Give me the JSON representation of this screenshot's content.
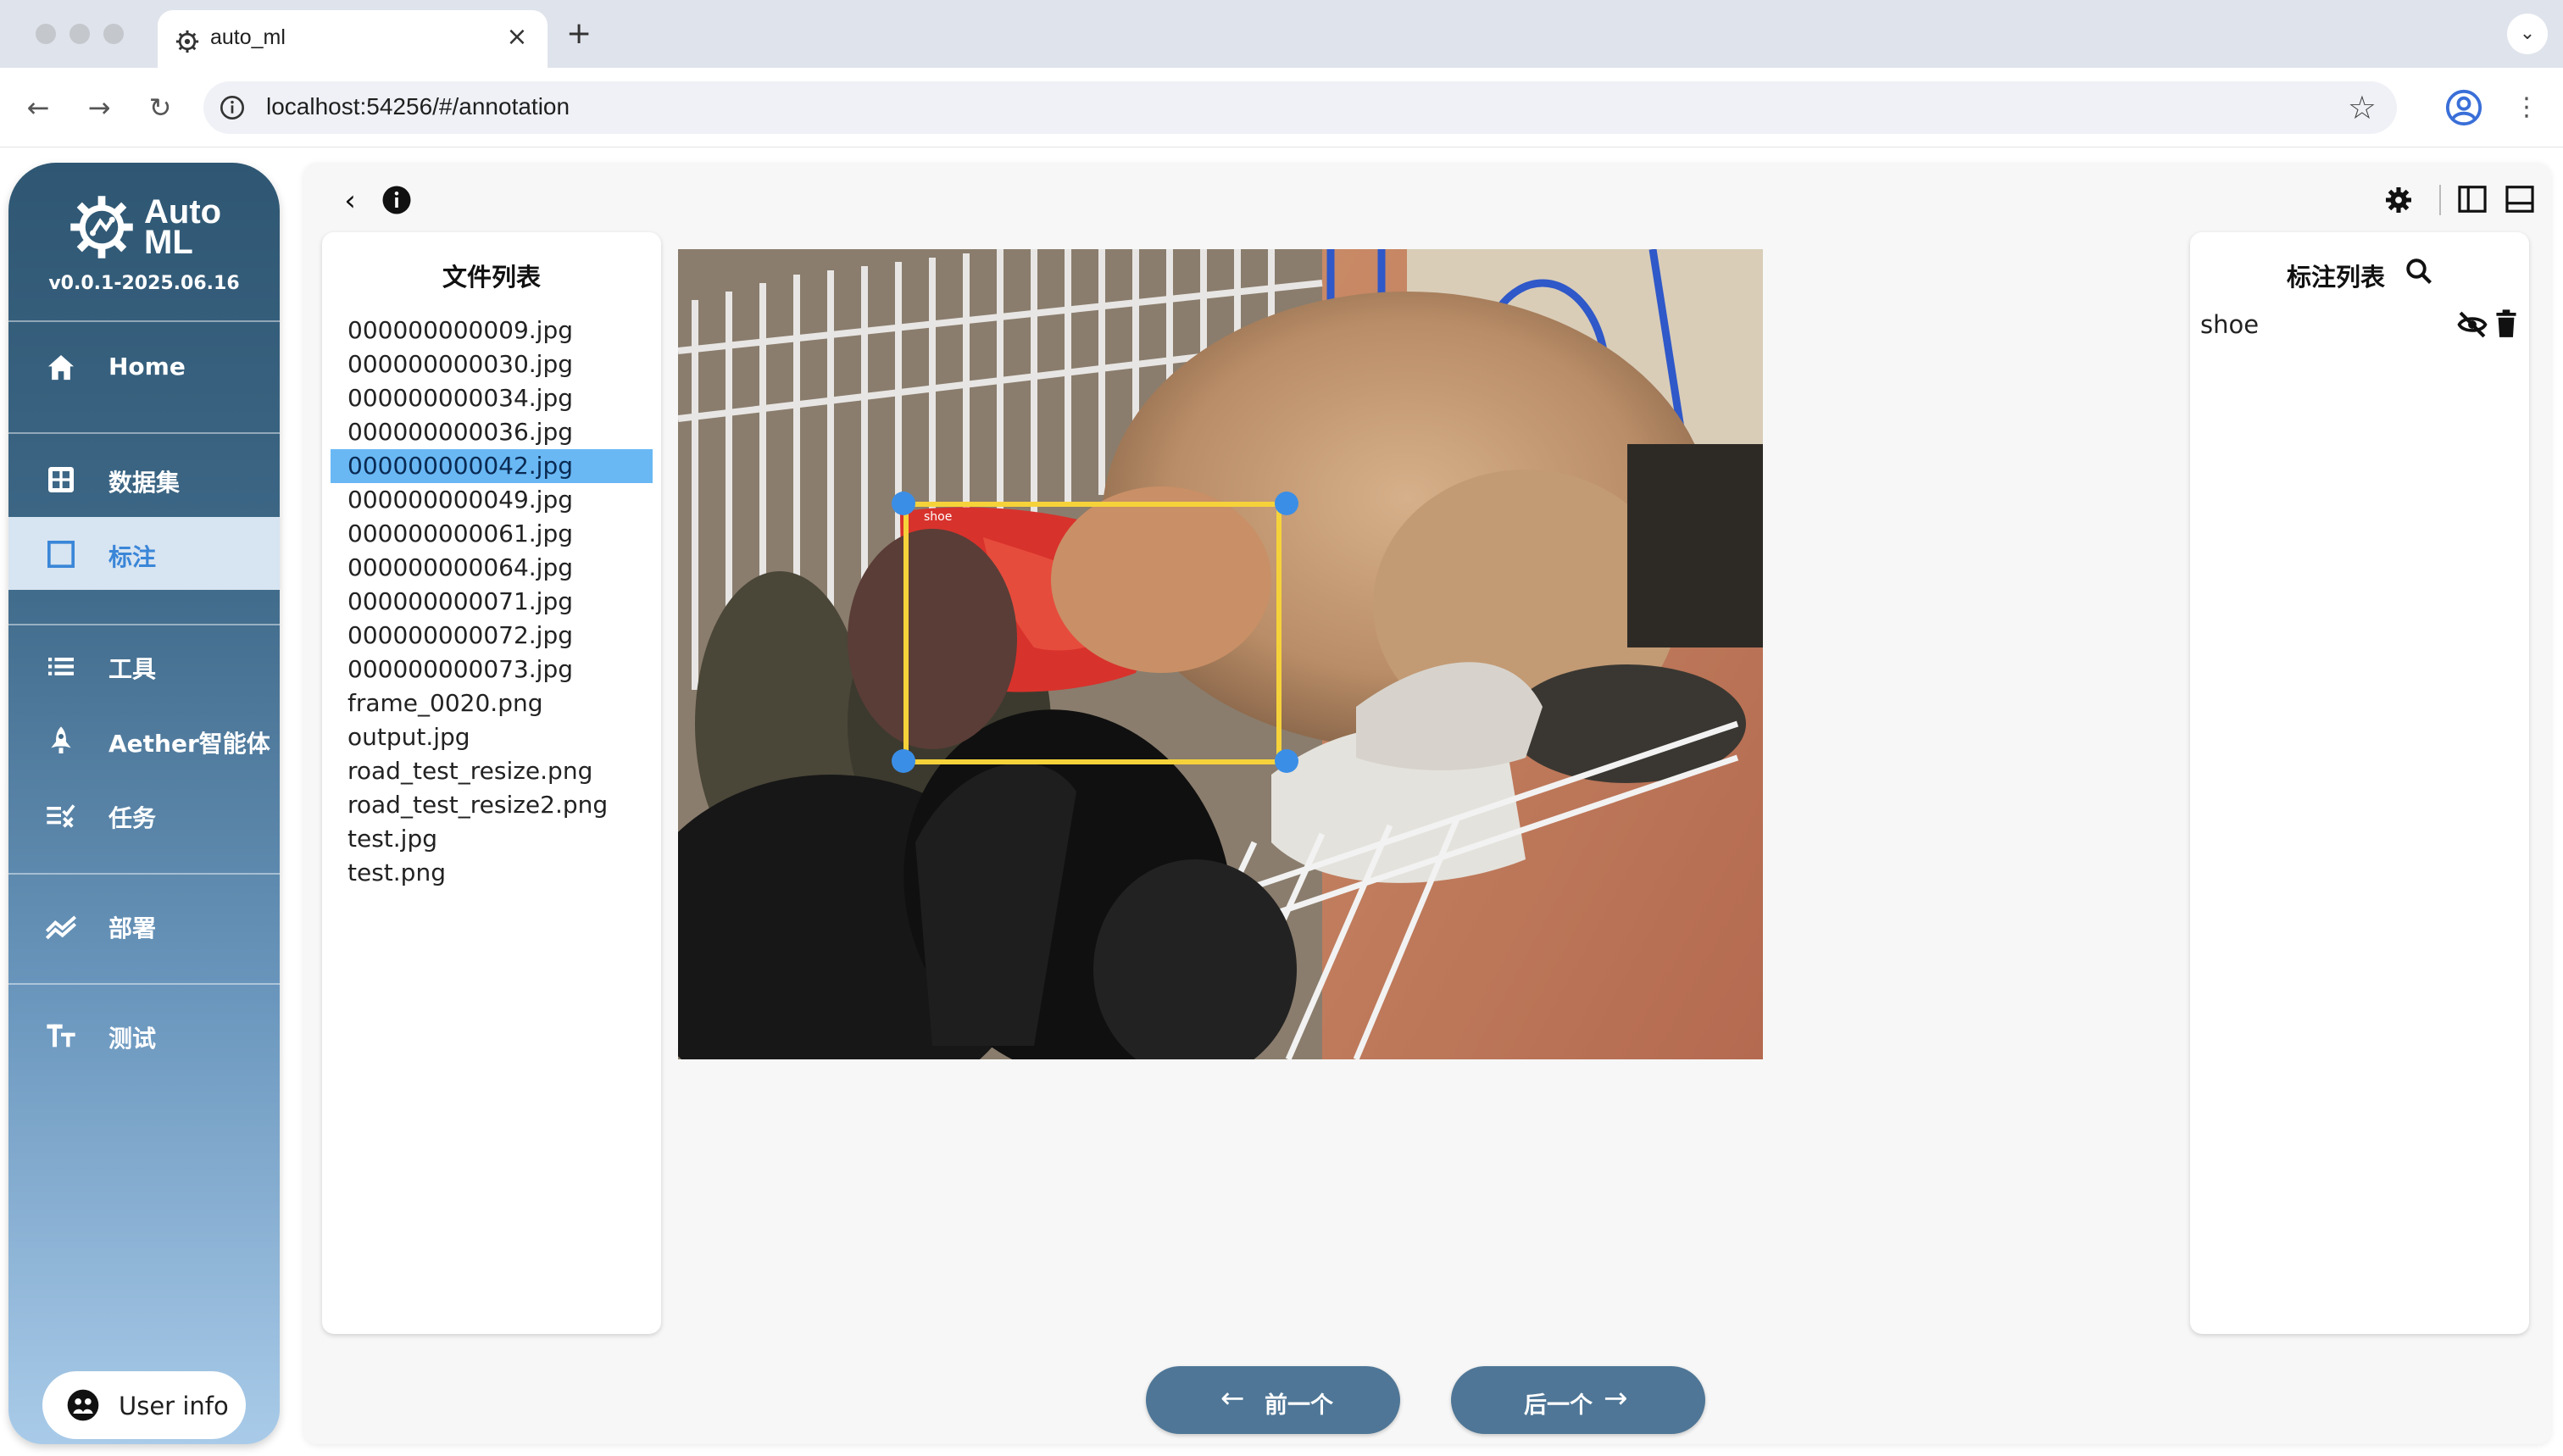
{
  "browser": {
    "tab_title": "auto_ml",
    "tab_close": "×",
    "new_tab": "+",
    "url": "localhost:54256/#/annotation"
  },
  "sidebar": {
    "brand_line1": "Auto",
    "brand_line2": "ML",
    "version": "v0.0.1-2025.06.16",
    "items": [
      {
        "label": "Home",
        "icon": "home-icon"
      },
      {
        "label": "数据集",
        "icon": "dataset-grid-icon"
      },
      {
        "label": "标注",
        "icon": "annotation-square-icon",
        "active": true
      },
      {
        "label": "工具",
        "icon": "list-icon"
      },
      {
        "label": "Aether智能体",
        "icon": "rocket-icon"
      },
      {
        "label": "任务",
        "icon": "tasks-checklist-icon"
      },
      {
        "label": "部署",
        "icon": "deploy-chart-icon"
      },
      {
        "label": "测试",
        "icon": "text-tt-icon"
      }
    ],
    "user_info": "User info"
  },
  "file_panel": {
    "title": "文件列表",
    "files": [
      "000000000009.jpg",
      "000000000030.jpg",
      "000000000034.jpg",
      "000000000036.jpg",
      "000000000042.jpg",
      "000000000049.jpg",
      "000000000061.jpg",
      "000000000064.jpg",
      "000000000071.jpg",
      "000000000072.jpg",
      "000000000073.jpg",
      "frame_0020.png",
      "output.jpg",
      "road_test_resize.png",
      "road_test_resize2.png",
      "test.jpg",
      "test.png"
    ],
    "selected_index": 4
  },
  "canvas": {
    "bbox_label": "shoe"
  },
  "annotation_panel": {
    "title": "标注列表",
    "items": [
      {
        "label": "shoe"
      }
    ]
  },
  "navigation": {
    "prev_label": "前一个",
    "next_label": "后一个",
    "prev_arrow": "←",
    "next_arrow": "→"
  },
  "colors": {
    "selected_file_bg": "#69b8f4",
    "bbox_border": "#f6d23a",
    "bbox_handle": "#3b8ee6",
    "nav_button_bg": "#4f7696",
    "active_nav_text": "#3a86d8"
  }
}
